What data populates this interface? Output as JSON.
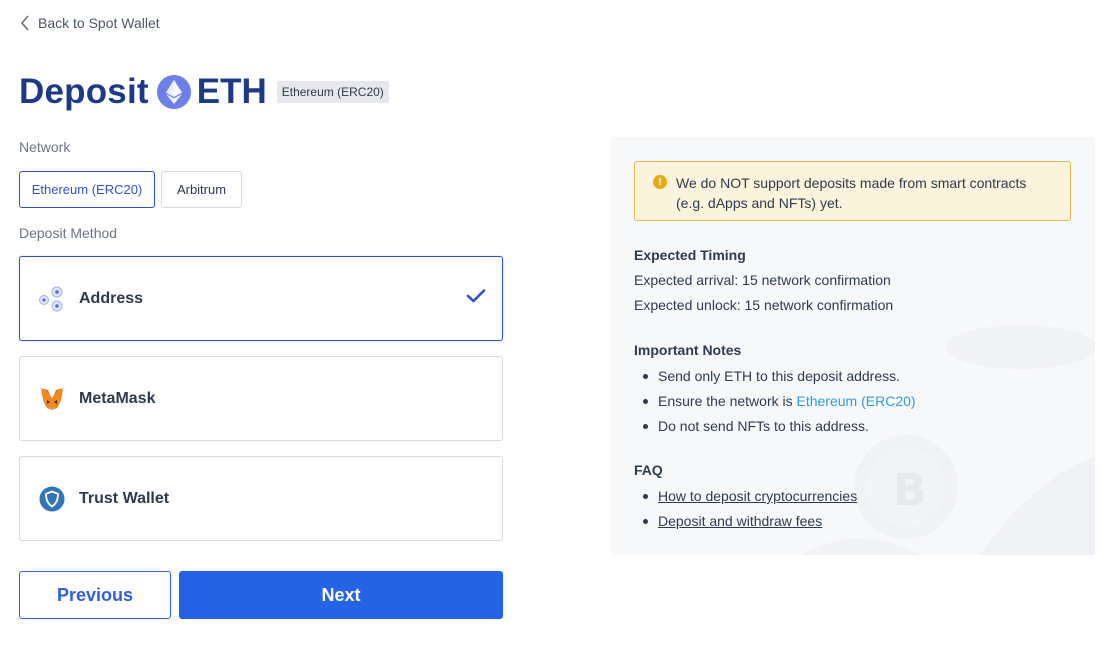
{
  "nav": {
    "back_label": "Back to Spot Wallet"
  },
  "header": {
    "title_word": "Deposit",
    "coin": "ETH",
    "network_chip": "Ethereum (ERC20)"
  },
  "network": {
    "label": "Network",
    "options": [
      {
        "label": "Ethereum (ERC20)",
        "selected": true
      },
      {
        "label": "Arbitrum",
        "selected": false
      }
    ]
  },
  "deposit_method": {
    "label": "Deposit Method",
    "options": [
      {
        "label": "Address",
        "icon": "address-icon",
        "selected": true
      },
      {
        "label": "MetaMask",
        "icon": "metamask-fox-icon",
        "selected": false
      },
      {
        "label": "Trust Wallet",
        "icon": "trust-wallet-shield-icon",
        "selected": false
      }
    ]
  },
  "actions": {
    "previous": "Previous",
    "next": "Next"
  },
  "info": {
    "warning": "We do NOT support deposits made from smart contracts (e.g. dApps and NFTs) yet.",
    "timing": {
      "heading": "Expected Timing",
      "arrival": "Expected arrival: 15 network confirmation",
      "unlock": "Expected unlock: 15 network confirmation"
    },
    "notes": {
      "heading": "Important Notes",
      "items": [
        "Send only ETH to this deposit address.",
        "Ensure the network is ",
        "Do not send NFTs to this address."
      ],
      "network_link": "Ethereum (ERC20)"
    },
    "faq": {
      "heading": "FAQ",
      "links": [
        "How to deposit cryptocurrencies",
        "Deposit and withdraw fees"
      ]
    }
  },
  "colors": {
    "brand_navy": "#1c3a86",
    "primary_blue": "#2563e6",
    "warning_bg": "#fcf3dd",
    "link_blue": "#2d9cdb"
  }
}
